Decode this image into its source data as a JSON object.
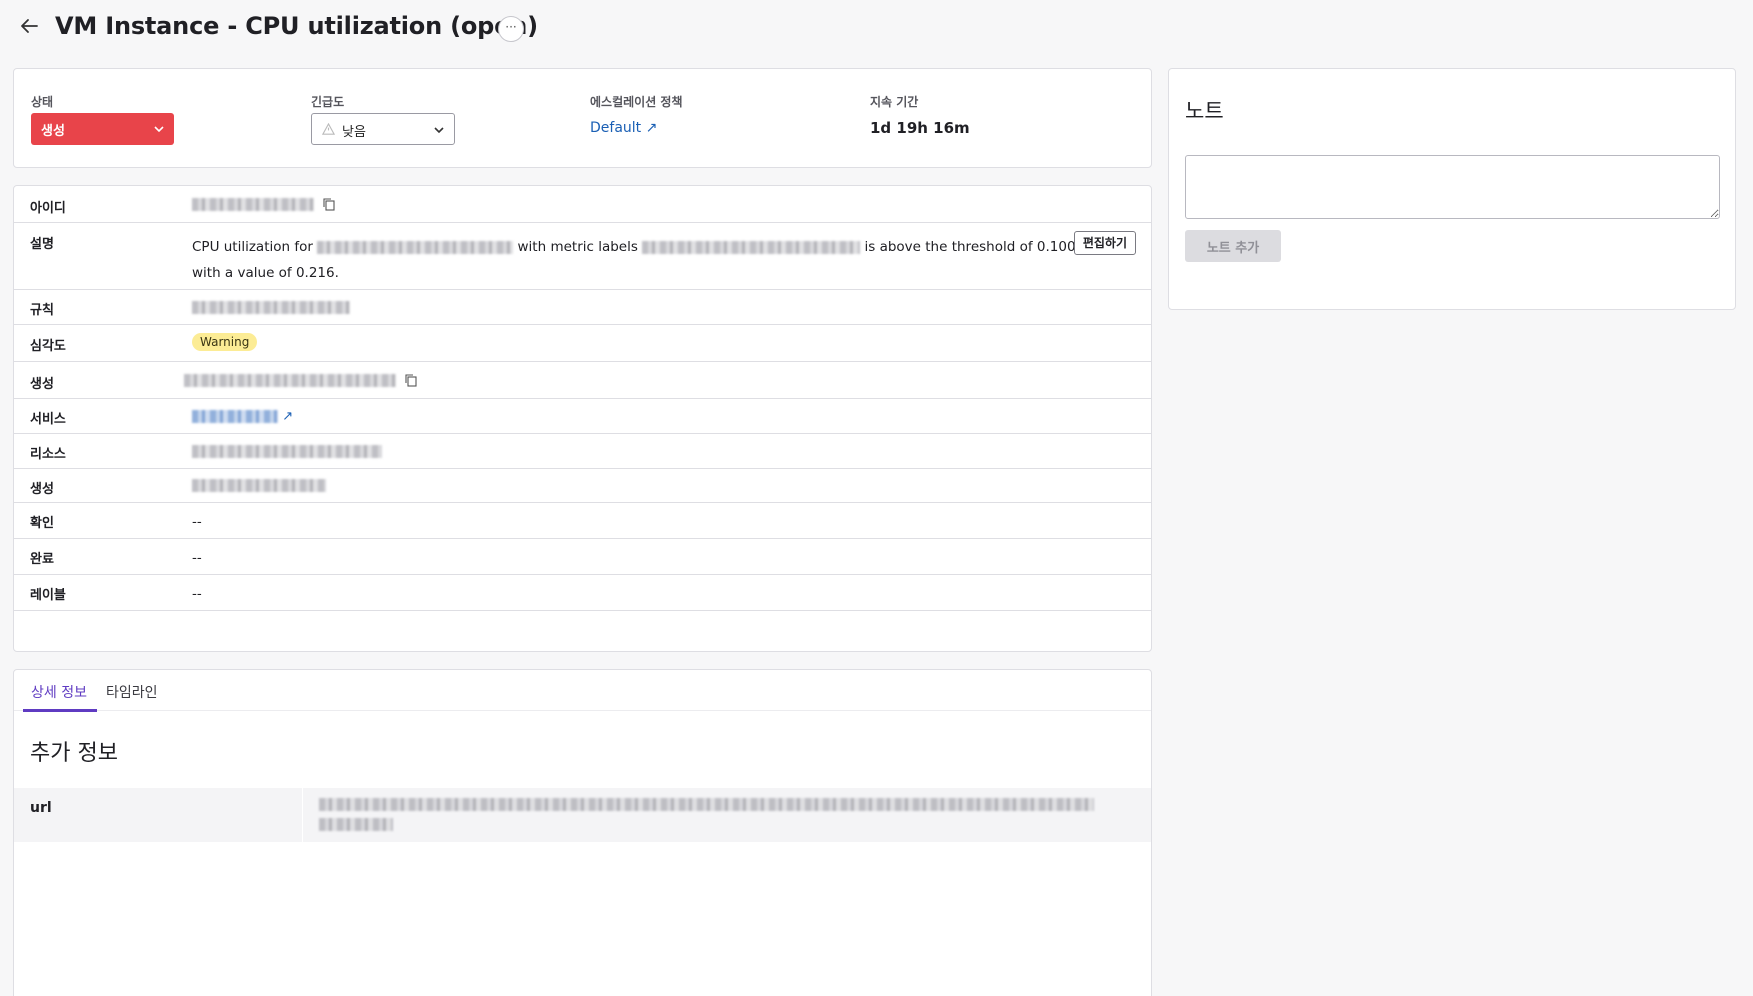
{
  "header": {
    "title": "VM Instance - CPU utilization (open)",
    "more_label": "···"
  },
  "status": {
    "state_label": "상태",
    "state_value": "생성",
    "urgency_label": "긴급도",
    "urgency_value": "낮음",
    "escalation_label": "에스컬레이션 정책",
    "escalation_value": "Default ↗",
    "duration_label": "지속 기간",
    "duration_value": "1d 19h 16m"
  },
  "details": {
    "id_label": "아이디",
    "description_label": "설명",
    "description_parts": {
      "prefix": "CPU utilization for",
      "middle": "with metric labels",
      "suffix": "is above the threshold of 0.100",
      "line2": "with a value of 0.216."
    },
    "edit_button": "편집하기",
    "rule_label": "규칙",
    "severity_label": "심각도",
    "severity_value": "Warning",
    "created_by_label": "생성",
    "service_label": "서비스",
    "service_arrow": "↗",
    "resource_label": "리소스",
    "created_label": "생성",
    "acknowledged_label": "확인",
    "acknowledged_value": "--",
    "resolved_label": "완료",
    "resolved_value": "--",
    "labels_label": "레이블",
    "labels_value": "--"
  },
  "notes": {
    "title": "노트",
    "add_button": "노트 추가",
    "input_value": ""
  },
  "tabs": {
    "details": "상세 정보",
    "timeline": "타임라인"
  },
  "extra": {
    "title": "추가 정보",
    "url_key": "url"
  },
  "colors": {
    "state_red": "#e8444a",
    "link_blue": "#1a5fb4",
    "tab_purple": "#5f3bc2",
    "warning_yellow": "#fcec95"
  }
}
